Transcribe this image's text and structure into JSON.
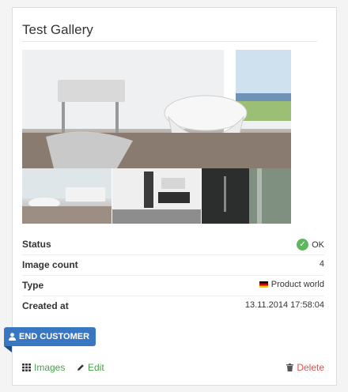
{
  "gallery": {
    "title": "Test Gallery",
    "status": {
      "label": "Status",
      "value": "OK",
      "icon": "check-circle-icon",
      "color": "#5cb85c"
    },
    "image_count": {
      "label": "Image count",
      "value": "4"
    },
    "type": {
      "label": "Type",
      "value": "Product world",
      "icon": "german-flag-icon"
    },
    "created_at": {
      "label": "Created at",
      "value": "13.11.2014 17:58:04"
    }
  },
  "badge": {
    "label": "END CUSTOMER",
    "icon": "user-icon",
    "color": "#3a77c2"
  },
  "actions": {
    "images": {
      "label": "Images",
      "icon": "grid-icon"
    },
    "edit": {
      "label": "Edit",
      "icon": "pencil-icon"
    },
    "delete": {
      "label": "Delete",
      "icon": "trash-icon",
      "color": "#d9534f"
    }
  }
}
